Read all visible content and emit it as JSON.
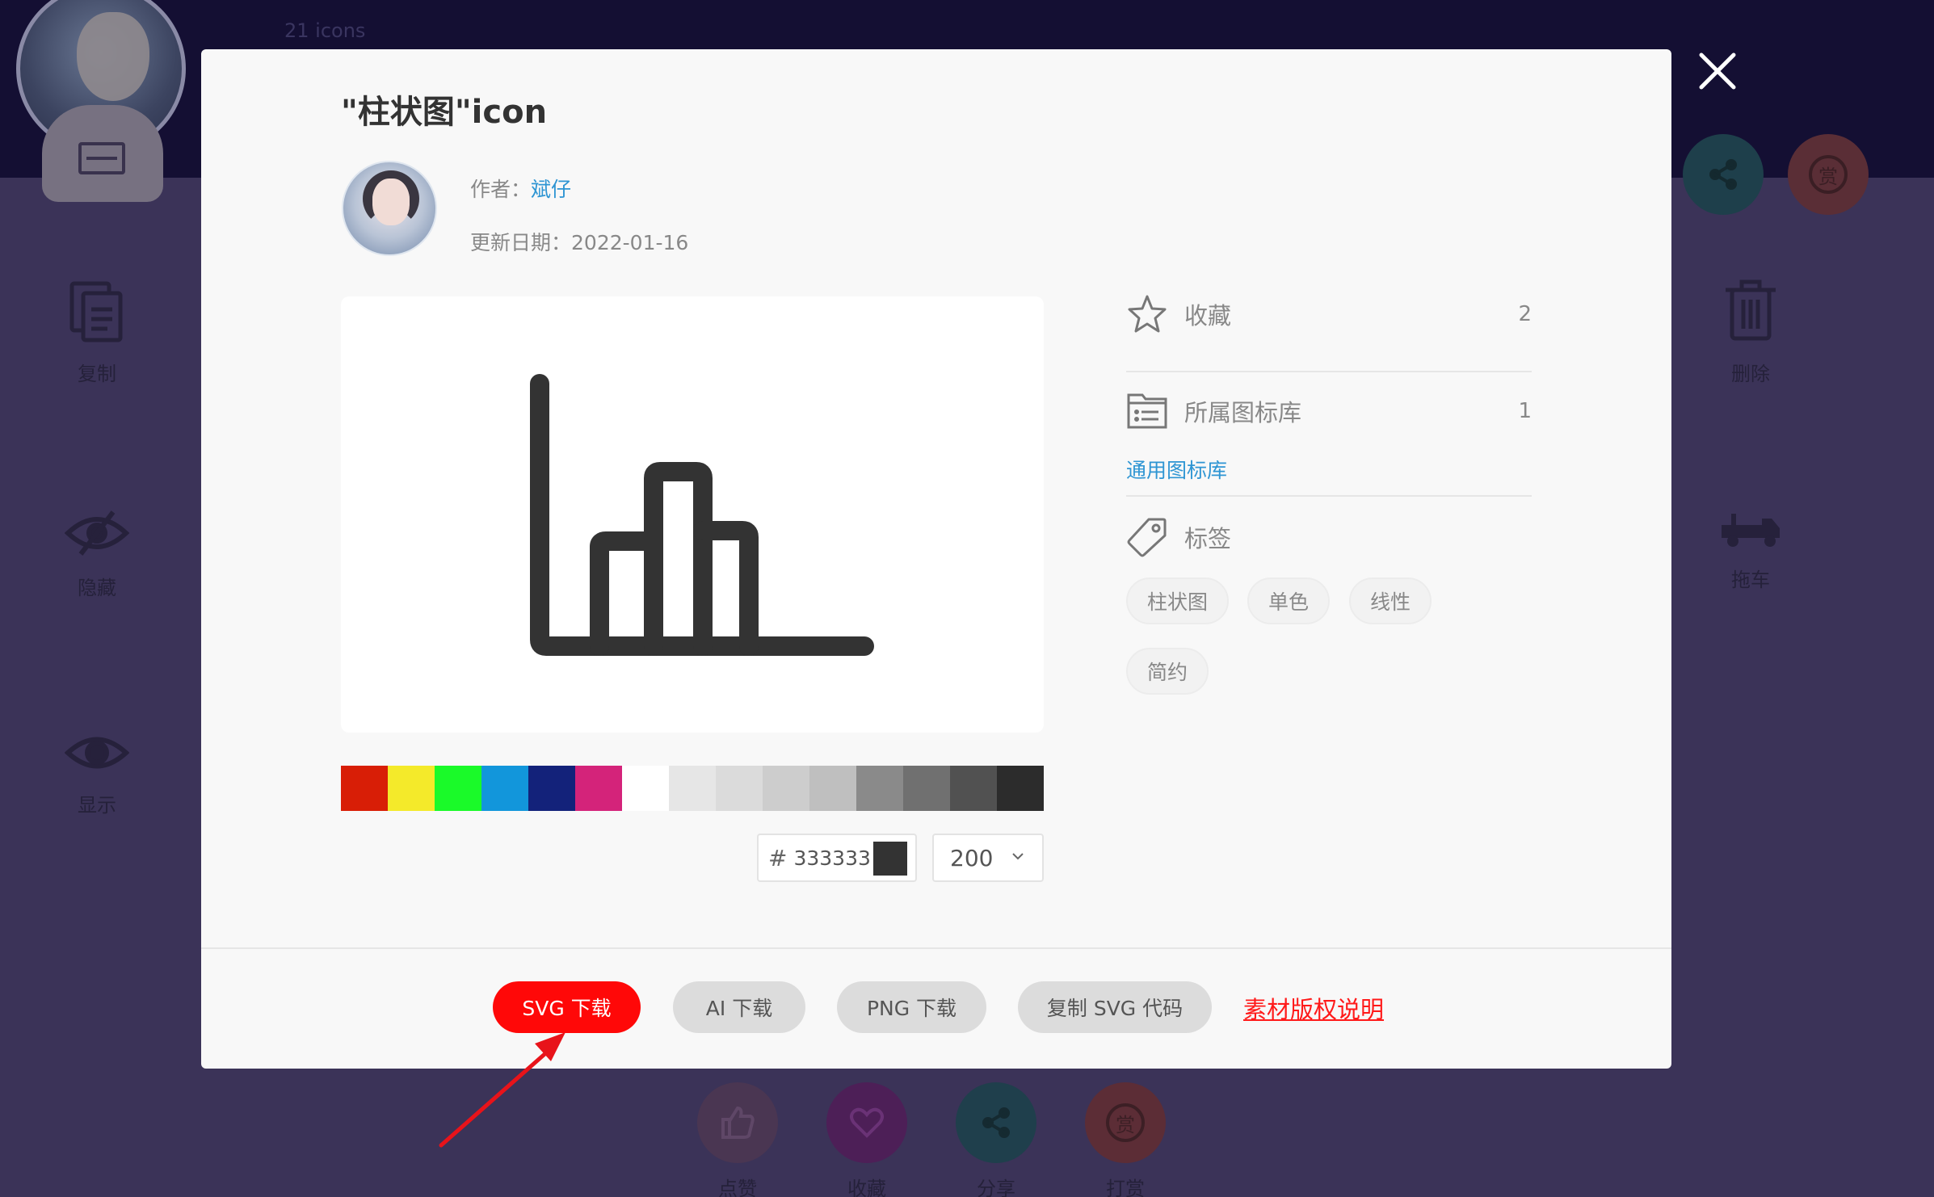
{
  "background": {
    "icon_count": "21 icons",
    "side_actions": {
      "copy": "复制",
      "delete": "删除",
      "hide": "隐藏",
      "tow": "拖车",
      "show": "显示"
    },
    "bottom_actions": {
      "like": "点赞",
      "favorite": "收藏",
      "share": "分享",
      "reward": "打赏"
    },
    "reward_glyph": "赏"
  },
  "modal": {
    "title": "\"柱状图\"icon",
    "author_label": "作者：",
    "author_name": "斌仔",
    "date_label": "更新日期：",
    "date_value": "2022-01-16",
    "preview_icon": "bar-chart-icon",
    "palette": [
      "#d81e06",
      "#f4ea2a",
      "#1afa29",
      "#1296db",
      "#13227a",
      "#d4237a",
      "#ffffff",
      "#e6e6e6",
      "#dbdbdb",
      "#cdcdcd",
      "#bfbfbf",
      "#8a8a8a",
      "#707070",
      "#515151",
      "#2c2c2c"
    ],
    "color_hash": "#",
    "color_value": "333333",
    "icon_color": "#333333",
    "size_value": "200",
    "favorites_label": "收藏",
    "favorites_count": "2",
    "library_label": "所属图标库",
    "library_count": "1",
    "library_link": "通用图标库",
    "tags_label": "标签",
    "tags": [
      "柱状图",
      "单色",
      "线性",
      "简约"
    ],
    "buttons": {
      "svg": "SVG 下载",
      "ai": "AI 下载",
      "png": "PNG 下载",
      "copy_svg": "复制 SVG 代码"
    },
    "copyright_link": "素材版权说明"
  }
}
